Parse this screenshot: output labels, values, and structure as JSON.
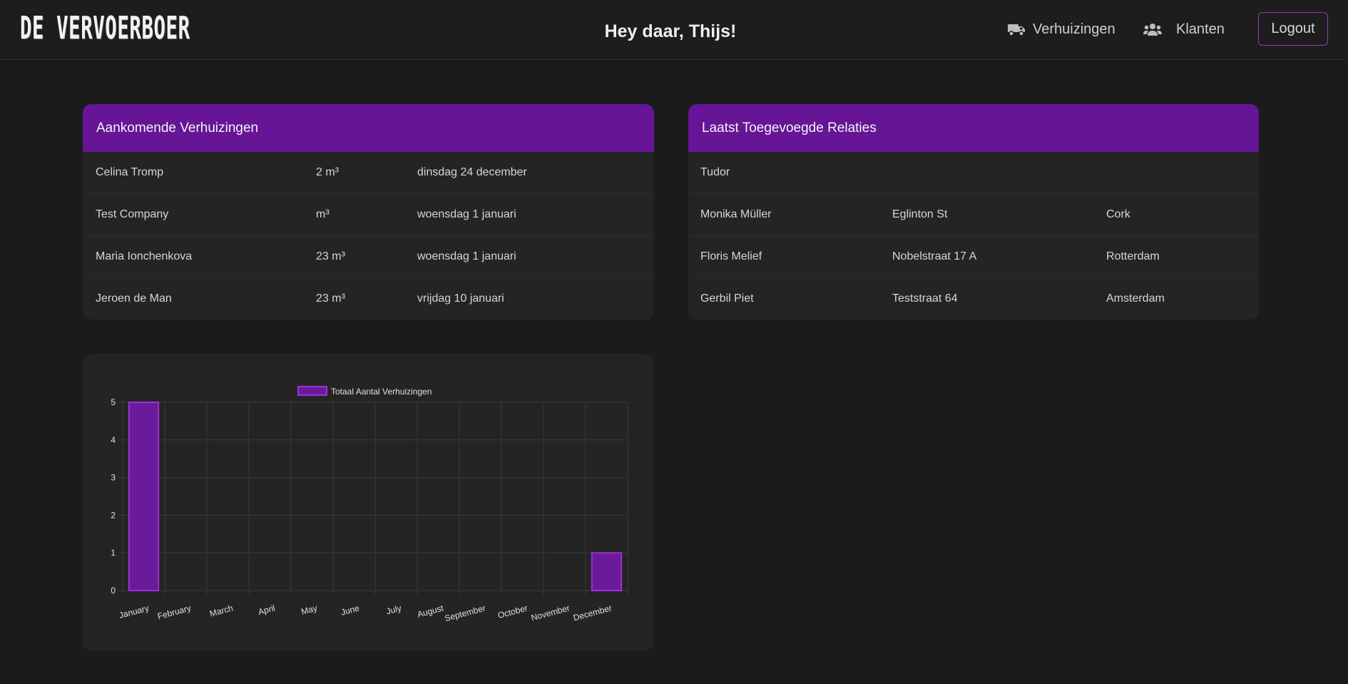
{
  "header": {
    "logo_text": "DE VERVOERBOER",
    "greeting": "Hey daar, Thijs!",
    "nav": {
      "moves_label": "Verhuizingen",
      "moves_icon": "truck-icon",
      "clients_label": "Klanten",
      "clients_icon": "users-icon"
    },
    "logout_label": "Logout"
  },
  "upcoming": {
    "title": "Aankomende Verhuizingen",
    "rows": [
      {
        "name": "Celina Tromp",
        "volume": "2 m³",
        "date": "dinsdag 24 december"
      },
      {
        "name": "Test Company",
        "volume": "m³",
        "date": "woensdag 1 januari"
      },
      {
        "name": "Maria Ionchenkova",
        "volume": "23 m³",
        "date": "woensdag 1 januari"
      },
      {
        "name": "Jeroen de Man",
        "volume": "23 m³",
        "date": "vrijdag 10 januari"
      }
    ]
  },
  "relations": {
    "title": "Laatst Toegevoegde Relaties",
    "rows": [
      {
        "name": "Tudor",
        "street": "",
        "city": ""
      },
      {
        "name": "Monika Müller",
        "street": "Eglinton St",
        "city": "Cork"
      },
      {
        "name": "Floris Melief",
        "street": "Nobelstraat 17 A",
        "city": "Rotterdam"
      },
      {
        "name": "Gerbil Piet",
        "street": "Teststraat 64",
        "city": "Amsterdam"
      }
    ]
  },
  "colors": {
    "accent": "#651596",
    "bar_fill": "#6a1b9a",
    "bar_border": "#9b2fd6",
    "card_bg": "#242424",
    "page_bg": "#1b1b1b"
  },
  "chart_data": {
    "type": "bar",
    "categories": [
      "January",
      "February",
      "March",
      "April",
      "May",
      "June",
      "July",
      "August",
      "September",
      "October",
      "November",
      "December"
    ],
    "series": [
      {
        "name": "Totaal Aantal Verhuizingen",
        "values": [
          5,
          0,
          0,
          0,
          0,
          0,
          0,
          0,
          0,
          0,
          0,
          1
        ]
      }
    ],
    "ylim": [
      0,
      5
    ],
    "yticks": [
      0,
      1,
      2,
      3,
      4,
      5
    ],
    "grid": true,
    "legend": "top-center"
  }
}
